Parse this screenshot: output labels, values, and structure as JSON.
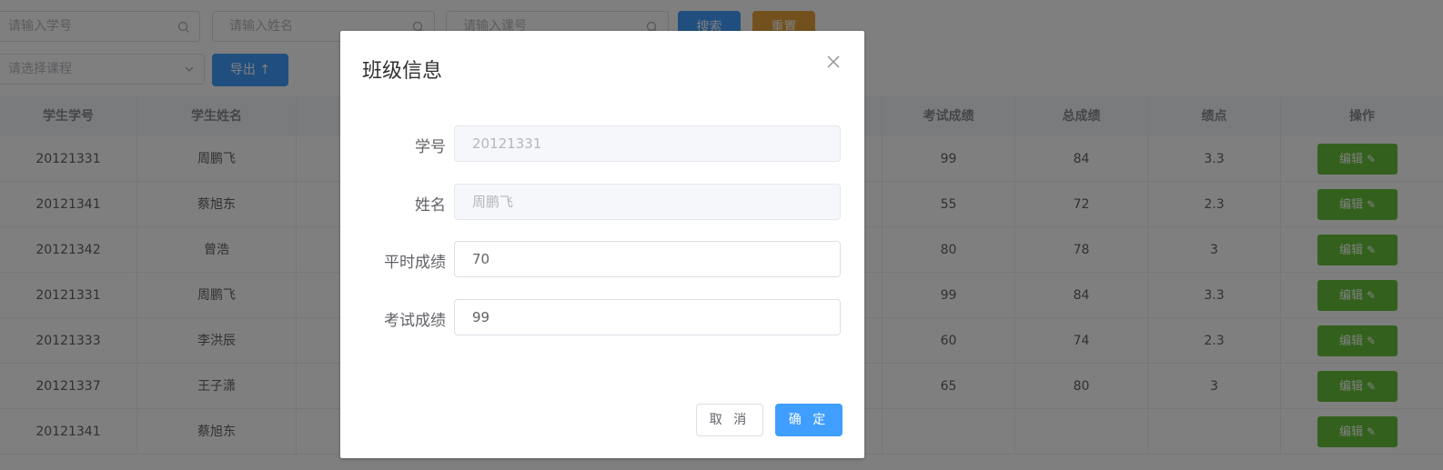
{
  "search": {
    "student_id_placeholder": "请输入学号",
    "name_placeholder": "请输入姓名",
    "course_placeholder": "请输入课号",
    "course_select_placeholder": "请选择课程",
    "search_label": "搜索",
    "reset_label": "重置",
    "export_label": "导出",
    "export_icon": "arrow-up-icon"
  },
  "table": {
    "headers": {
      "student_id": "学生学号",
      "student_name": "学生姓名",
      "exam_score": "考试成绩",
      "total_score": "总成绩",
      "gpa": "绩点",
      "actions": "操作"
    },
    "edit_label": "编辑",
    "rows": [
      {
        "id": "20121331",
        "name": "周鹏飞",
        "exam": "99",
        "total": "84",
        "gpa": "3.3"
      },
      {
        "id": "20121341",
        "name": "蔡旭东",
        "exam": "55",
        "total": "72",
        "gpa": "2.3"
      },
      {
        "id": "20121342",
        "name": "曾浩",
        "exam": "80",
        "total": "78",
        "gpa": "3"
      },
      {
        "id": "20121331",
        "name": "周鹏飞",
        "exam": "99",
        "total": "84",
        "gpa": "3.3"
      },
      {
        "id": "20121333",
        "name": "李洪辰",
        "exam": "60",
        "total": "74",
        "gpa": "2.3"
      },
      {
        "id": "20121337",
        "name": "王子潇",
        "exam": "65",
        "total": "80",
        "gpa": "3"
      },
      {
        "id": "20121341",
        "name": "蔡旭东",
        "exam": "",
        "total": "",
        "gpa": ""
      }
    ]
  },
  "dialog": {
    "title": "班级信息",
    "fields": {
      "student_id_label": "学号",
      "student_id_value": "20121331",
      "name_label": "姓名",
      "name_value": "周鹏飞",
      "usual_score_label": "平时成绩",
      "usual_score_value": "70",
      "exam_score_label": "考试成绩",
      "exam_score_value": "99"
    },
    "cancel_label": "取 消",
    "confirm_label": "确 定"
  },
  "colors": {
    "primary": "#409eff",
    "warning": "#e6a23c",
    "success": "#67c23a",
    "overlay": "rgba(0,0,0,0.5)"
  }
}
